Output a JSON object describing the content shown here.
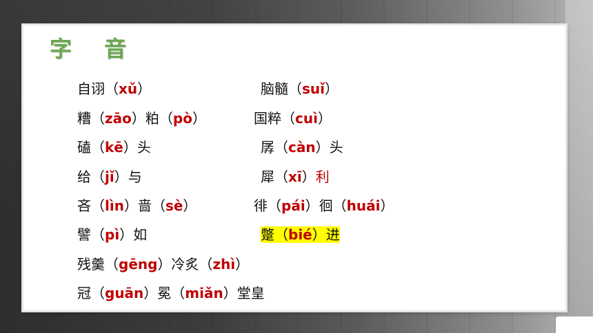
{
  "title": "字 音",
  "left_column": {
    "r1": {
      "a": "自诩（",
      "p1": "xǔ",
      "b": "）"
    },
    "r2": {
      "a": "糟（",
      "p1": "zāo",
      "b": "）粕（",
      "p2": "pò",
      "c": "）"
    },
    "r3": {
      "a": "磕（",
      "p1": "kē",
      "b": "）头"
    },
    "r4": {
      "a": "给（",
      "p1": "jǐ",
      "b": "）与"
    },
    "r5": {
      "a": "吝（",
      "p1": "lìn",
      "b": "）啬（",
      "p2": "sè",
      "c": "）"
    },
    "r6": {
      "a": "譬（",
      "p1": "pì",
      "b": "）如"
    },
    "r7": {
      "a": "残羹（",
      "p1": "gēng",
      "b": "）冷炙（",
      "p2": "zhì",
      "c": "）"
    },
    "r8": {
      "a": "冠（",
      "p1": "guān",
      "b": "）冕（",
      "p2": "miǎn",
      "c": "）堂皇"
    }
  },
  "right_column": {
    "r1": {
      "a": "脑髓（",
      "p1": "suǐ",
      "b": "）"
    },
    "r2": {
      "a": "国粹（",
      "p1": "cuì",
      "b": "）"
    },
    "r3": {
      "a": "孱（",
      "p1": "càn",
      "b": "）头"
    },
    "r4": {
      "a": "犀（",
      "p1": "xī",
      "b": "）",
      "c": "利"
    },
    "r5": {
      "a": "徘（",
      "p1": "pái",
      "b": "）徊（",
      "p2": "huái",
      "c": "）"
    },
    "r6": {
      "a": "蹩（",
      "p1": "bié",
      "b": "）进"
    }
  },
  "colors": {
    "title": "#6aa84f",
    "pinyin": "#c00000",
    "highlight": "#ffff00"
  }
}
